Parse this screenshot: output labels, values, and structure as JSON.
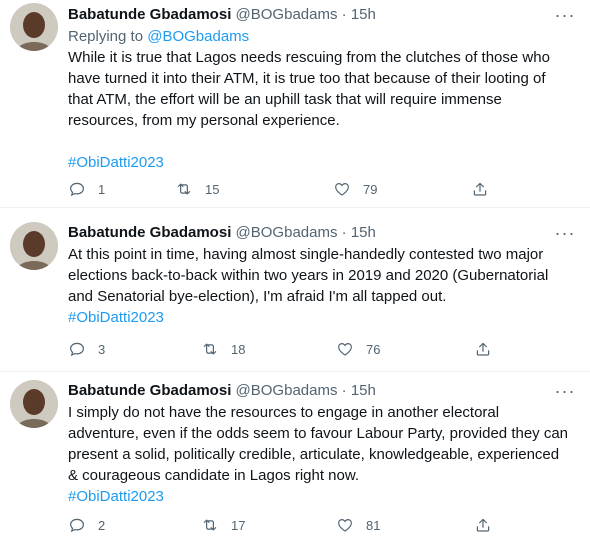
{
  "tweets": [
    {
      "name": "Babatunde Gbadamosi",
      "handle": "@BOGbadams",
      "time": "15h",
      "replying_label": "Replying to",
      "replying_handle": "@BOGbadams",
      "text": "While it is true that Lagos needs rescuing from the clutches of those who have turned it into their ATM, it is true too that because of their looting of that ATM, the effort will be an uphill task that will require immense resources, from my personal experience.",
      "hashtag": "#ObiDatti2023",
      "replies": "1",
      "retweets": "15",
      "likes": "79"
    },
    {
      "name": "Babatunde Gbadamosi",
      "handle": "@BOGbadams",
      "time": "15h",
      "text": "At this point in time, having almost single-handedly contested two major elections back-to-back within two years in 2019 and 2020 (Gubernatorial and Senatorial bye-election), I'm afraid I'm all tapped out.",
      "hashtag": "#ObiDatti2023",
      "replies": "3",
      "retweets": "18",
      "likes": "76"
    },
    {
      "name": "Babatunde Gbadamosi",
      "handle": "@BOGbadams",
      "time": "15h",
      "text": "I simply do not have the resources to engage in another electoral adventure, even if the odds seem to favour Labour Party, provided they can  present a solid, politically credible, articulate, knowledgeable, experienced & courageous candidate in Lagos right now.",
      "hashtag": "#ObiDatti2023",
      "replies": "2",
      "retweets": "17",
      "likes": "81"
    }
  ],
  "separator": "·",
  "colors": {
    "text": "#0f1419",
    "secondary": "#536471",
    "link": "#1d9bf0",
    "divider": "#eff3f4"
  },
  "icons": [
    "more-icon",
    "reply-icon",
    "retweet-icon",
    "like-icon",
    "share-icon"
  ]
}
